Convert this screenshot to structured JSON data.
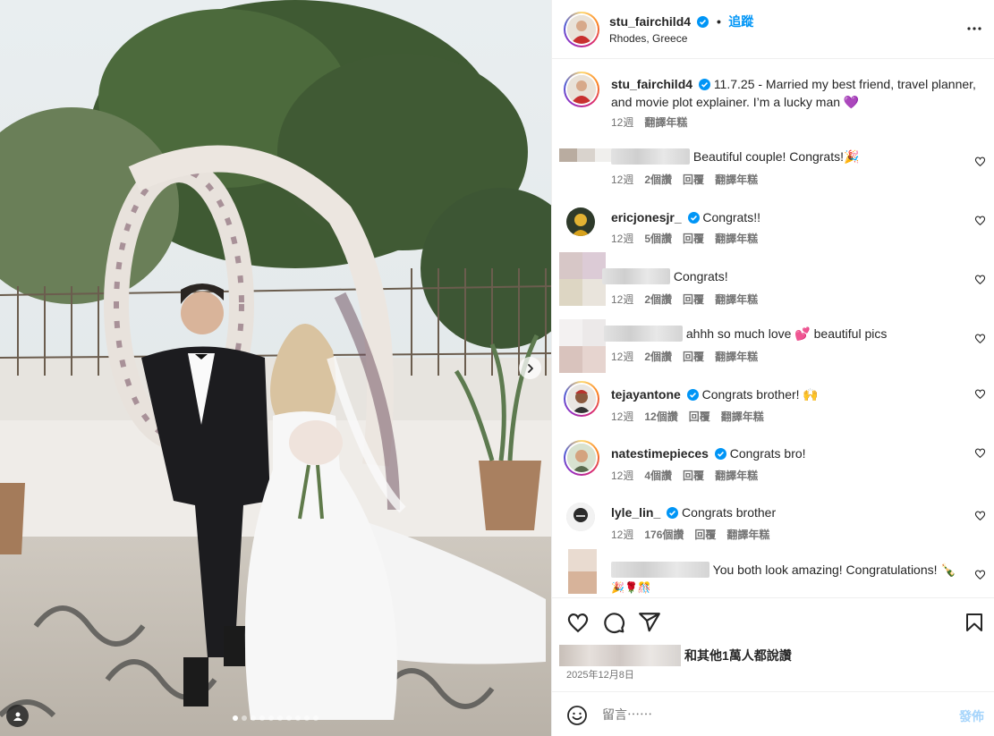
{
  "post": {
    "username": "stu_fairchild4",
    "follow_label": "追蹤",
    "separator": "•",
    "location": "Rhodes, Greece",
    "caption": "11.7.25 - Married my best friend, travel planner, and movie plot explainer. I’m a lucky man 💜",
    "caption_time": "12週",
    "caption_translate": "翻譯年糕"
  },
  "comments": [
    {
      "username": "",
      "text": "Beautiful couple! Congrats!🎉",
      "time": "12週",
      "likes": "2個讚",
      "reply": "回覆",
      "translate": "翻譯年糕"
    },
    {
      "username": "ericjonesjr_",
      "text": "Congrats!!",
      "time": "12週",
      "likes": "5個讚",
      "reply": "回覆",
      "translate": "翻譯年糕"
    },
    {
      "username": "",
      "text": "Congrats!",
      "time": "12週",
      "likes": "2個讚",
      "reply": "回覆",
      "translate": "翻譯年糕"
    },
    {
      "username": "",
      "text": "ahhh so much love 💕 beautiful pics",
      "time": "12週",
      "likes": "2個讚",
      "reply": "回覆",
      "translate": "翻譯年糕"
    },
    {
      "username": "tejayantone",
      "text": "Congrats brother! 🙌",
      "time": "12週",
      "likes": "12個讚",
      "reply": "回覆",
      "translate": "翻譯年糕"
    },
    {
      "username": "natestimepieces",
      "text": "Congrats bro!",
      "time": "12週",
      "likes": "4個讚",
      "reply": "回覆",
      "translate": "翻譯年糕"
    },
    {
      "username": "lyle_lin_",
      "text": "Congrats brother",
      "time": "12週",
      "likes": "176個讚",
      "reply": "回覆",
      "translate": "翻譯年糕"
    },
    {
      "username": "",
      "text": "You both look amazing! Congratulations! 🍾",
      "text2": "🎉🌹🎊",
      "time": "",
      "likes": "",
      "reply": "",
      "translate": ""
    }
  ],
  "footer": {
    "likes_text": "和其他1萬人都說讚",
    "date": "2025年12月8日",
    "comment_placeholder": "留言⋯⋯",
    "post_label": "發佈"
  },
  "icons": {
    "like": "heart-icon",
    "comment": "comment-icon",
    "share": "share-icon",
    "save": "bookmark-icon",
    "emoji": "emoji-icon",
    "more": "more-options-icon",
    "verified": "verified-badge-icon",
    "next": "chevron-right-icon",
    "tag": "user-tag-icon"
  },
  "colors": {
    "link": "#0095f6",
    "verified": "#0095f6",
    "muted": "#737373",
    "post_disabled": "#a5d4fb"
  }
}
